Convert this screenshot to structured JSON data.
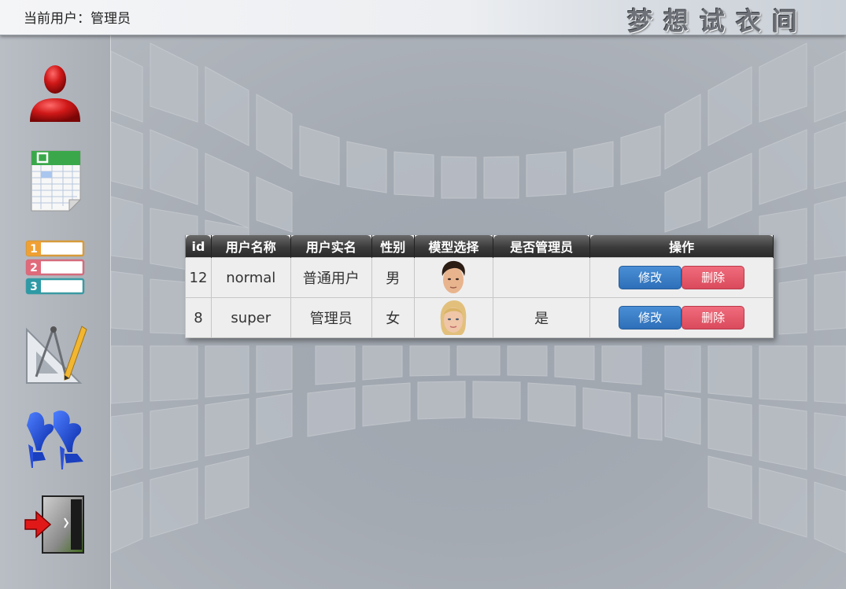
{
  "header": {
    "current_user_text": "当前用户：管理员",
    "brand_text": "梦想试衣间"
  },
  "sidebar": {
    "items": [
      {
        "icon": "user-icon"
      },
      {
        "icon": "spreadsheet-icon"
      },
      {
        "icon": "numbered-list-icon"
      },
      {
        "icon": "drafting-tools-icon"
      },
      {
        "icon": "high-heels-icon"
      },
      {
        "icon": "logout-icon"
      }
    ]
  },
  "table": {
    "headers": [
      "id",
      "用户名称",
      "用户实名",
      "性别",
      "模型选择",
      "是否管理员",
      "操作"
    ],
    "rows": [
      {
        "id": "12",
        "username": "normal",
        "realname": "普通用户",
        "gender": "男",
        "model": "male-face",
        "is_admin": "",
        "edit_label": "修改",
        "delete_label": "删除"
      },
      {
        "id": "8",
        "username": "super",
        "realname": "管理员",
        "gender": "女",
        "model": "female-face",
        "is_admin": "是",
        "edit_label": "修改",
        "delete_label": "删除"
      }
    ]
  },
  "colors": {
    "edit_button": "#3a7cc6",
    "delete_button": "#e25a6b",
    "header_cell": "#3b3b3b"
  }
}
